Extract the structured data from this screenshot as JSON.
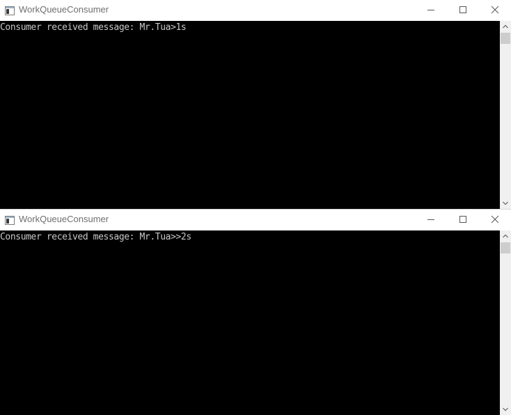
{
  "windows": [
    {
      "title": "WorkQueueConsumer",
      "icon": "console-app-icon",
      "output_lines": [
        "Consumer received message: Mr.Tua>1s"
      ]
    },
    {
      "title": "WorkQueueConsumer",
      "icon": "console-app-icon",
      "output_lines": [
        "Consumer received message: Mr.Tua>>2s"
      ]
    }
  ],
  "colors": {
    "console_background": "#000000",
    "console_text": "#c8c8c8",
    "title_text": "#6f6f6f",
    "scrollbar_track": "#f0f0f0",
    "scrollbar_thumb": "#cdcdcd"
  },
  "icons": {
    "minimize": "minimize-icon",
    "maximize": "maximize-icon",
    "close": "close-icon",
    "scroll_up": "chevron-up-icon",
    "scroll_down": "chevron-down-icon"
  }
}
